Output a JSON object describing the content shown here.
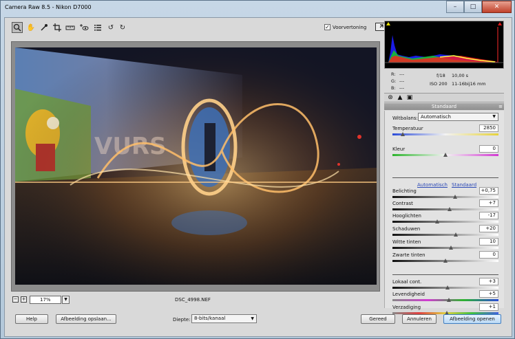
{
  "window": {
    "title": "Camera Raw 8.5  -  Nikon D7000"
  },
  "toolbar": {
    "tools": [
      "zoom-icon",
      "hand-icon",
      "white-balance-icon",
      "crop-icon",
      "straighten-icon",
      "red-eye-icon",
      "presets-list-icon",
      "rotate-left-icon",
      "rotate-right-icon"
    ],
    "preview_label": "Voorvertoning",
    "preview_checked": true
  },
  "image": {
    "filename": "DSC_4998.NEF"
  },
  "zoom": {
    "value": "17%"
  },
  "info": {
    "r_label": "R:",
    "g_label": "G:",
    "b_label": "B:",
    "rgb_value": "---",
    "aperture": "f/18",
    "shutter": "10,00 s",
    "iso": "ISO 200",
    "lens": "11-16bij16 mm"
  },
  "panel": {
    "title": "Standaard",
    "tabs": [
      "basic-icon",
      "tone-curve-icon",
      "detail-icon"
    ],
    "white_balance_label": "Witbalans:",
    "white_balance_value": "Automatisch",
    "auto_label": "Automatisch",
    "default_label": "Standaard",
    "sliders": [
      {
        "label": "Temperatuur",
        "value": "2850",
        "position": 0.1
      },
      {
        "label": "Kleur",
        "value": "0",
        "position": 0.5
      },
      {
        "label": "Belichting",
        "value": "+0,75",
        "position": 0.59
      },
      {
        "label": "Contrast",
        "value": "+7",
        "position": 0.54
      },
      {
        "label": "Hooglichten",
        "value": "-17",
        "position": 0.42
      },
      {
        "label": "Schaduwen",
        "value": "+20",
        "position": 0.6
      },
      {
        "label": "Witte tinten",
        "value": "10",
        "position": 0.55
      },
      {
        "label": "Zwarte tinten",
        "value": "0",
        "position": 0.5
      },
      {
        "label": "Lokaal cont.",
        "value": "+3",
        "position": 0.52
      },
      {
        "label": "Levendigheid",
        "value": "+5",
        "position": 0.53
      },
      {
        "label": "Verzadiging",
        "value": "+1",
        "position": 0.51
      }
    ]
  },
  "footer": {
    "help": "Help",
    "save": "Afbeelding opslaan...",
    "depth_label": "Diepte:",
    "depth_value": "8-bits/kanaal",
    "done": "Gereed",
    "cancel": "Annuleren",
    "open": "Afbeelding openen"
  },
  "colors": {
    "accent": "#3f7dc0",
    "link": "#2a48b5"
  }
}
